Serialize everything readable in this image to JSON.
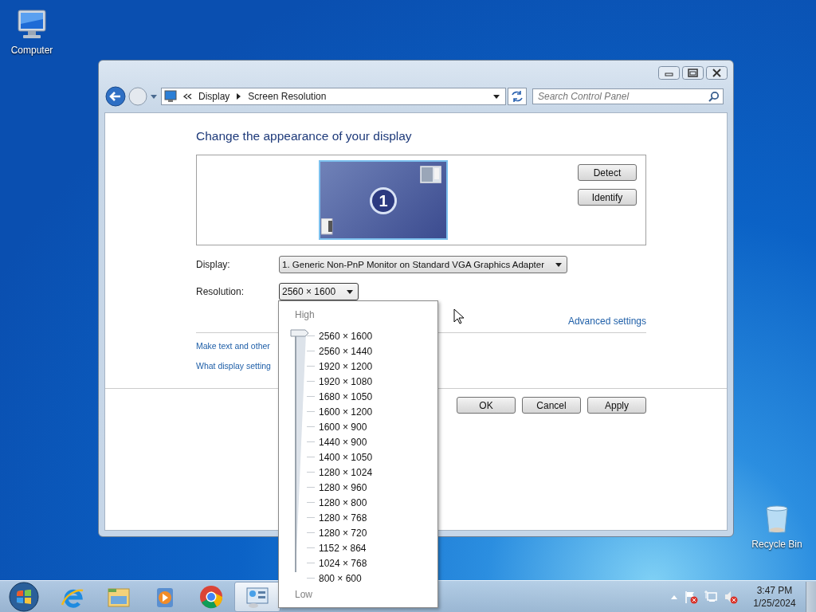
{
  "desktop_icons": [
    {
      "kind": "computer",
      "label": "Computer"
    },
    {
      "kind": "recycle",
      "label": "Recycle Bin"
    }
  ],
  "window": {
    "address_bar": {
      "crumbs": [
        "Display",
        "Screen Resolution"
      ]
    },
    "search": {
      "placeholder": "Search Control Panel"
    },
    "heading": "Change the appearance of your display",
    "preview": {
      "monitor_number": "1"
    },
    "side_buttons": [
      "Detect",
      "Identify"
    ],
    "fields": [
      {
        "label": "Display:",
        "value": "1. Generic Non-PnP Monitor on Standard VGA Graphics Adapter",
        "expanded": false
      },
      {
        "label": "Resolution:",
        "value": "2560 × 1600",
        "expanded": true
      }
    ],
    "advanced_link": "Advanced settings",
    "links": [
      "Make text and other",
      "What display setting"
    ],
    "footer_buttons": [
      "OK",
      "Cancel",
      "Apply"
    ]
  },
  "resolution_dropdown": {
    "high_label": "High",
    "low_label": "Low",
    "level": 1,
    "options": [
      "2560 × 1600",
      "2560 × 1440",
      "1920 × 1200",
      "1920 × 1080",
      "1680 × 1050",
      "1600 × 1200",
      "1600 × 900",
      "1440 × 900",
      "1400 × 1050",
      "1280 × 1024",
      "1280 × 960",
      "1280 × 800",
      "1280 × 768",
      "1280 × 720",
      "1152 × 864",
      "1024 × 768",
      "800 × 600"
    ]
  },
  "taskbar": {
    "apps": [
      {
        "kind": "browser-e",
        "active": false
      },
      {
        "kind": "folder",
        "active": false
      },
      {
        "kind": "media",
        "active": false
      },
      {
        "kind": "chrome",
        "active": false
      },
      {
        "kind": "control-panel",
        "active": true
      }
    ],
    "clock": {
      "time": "3:47 PM",
      "date": "1/25/2024"
    }
  }
}
